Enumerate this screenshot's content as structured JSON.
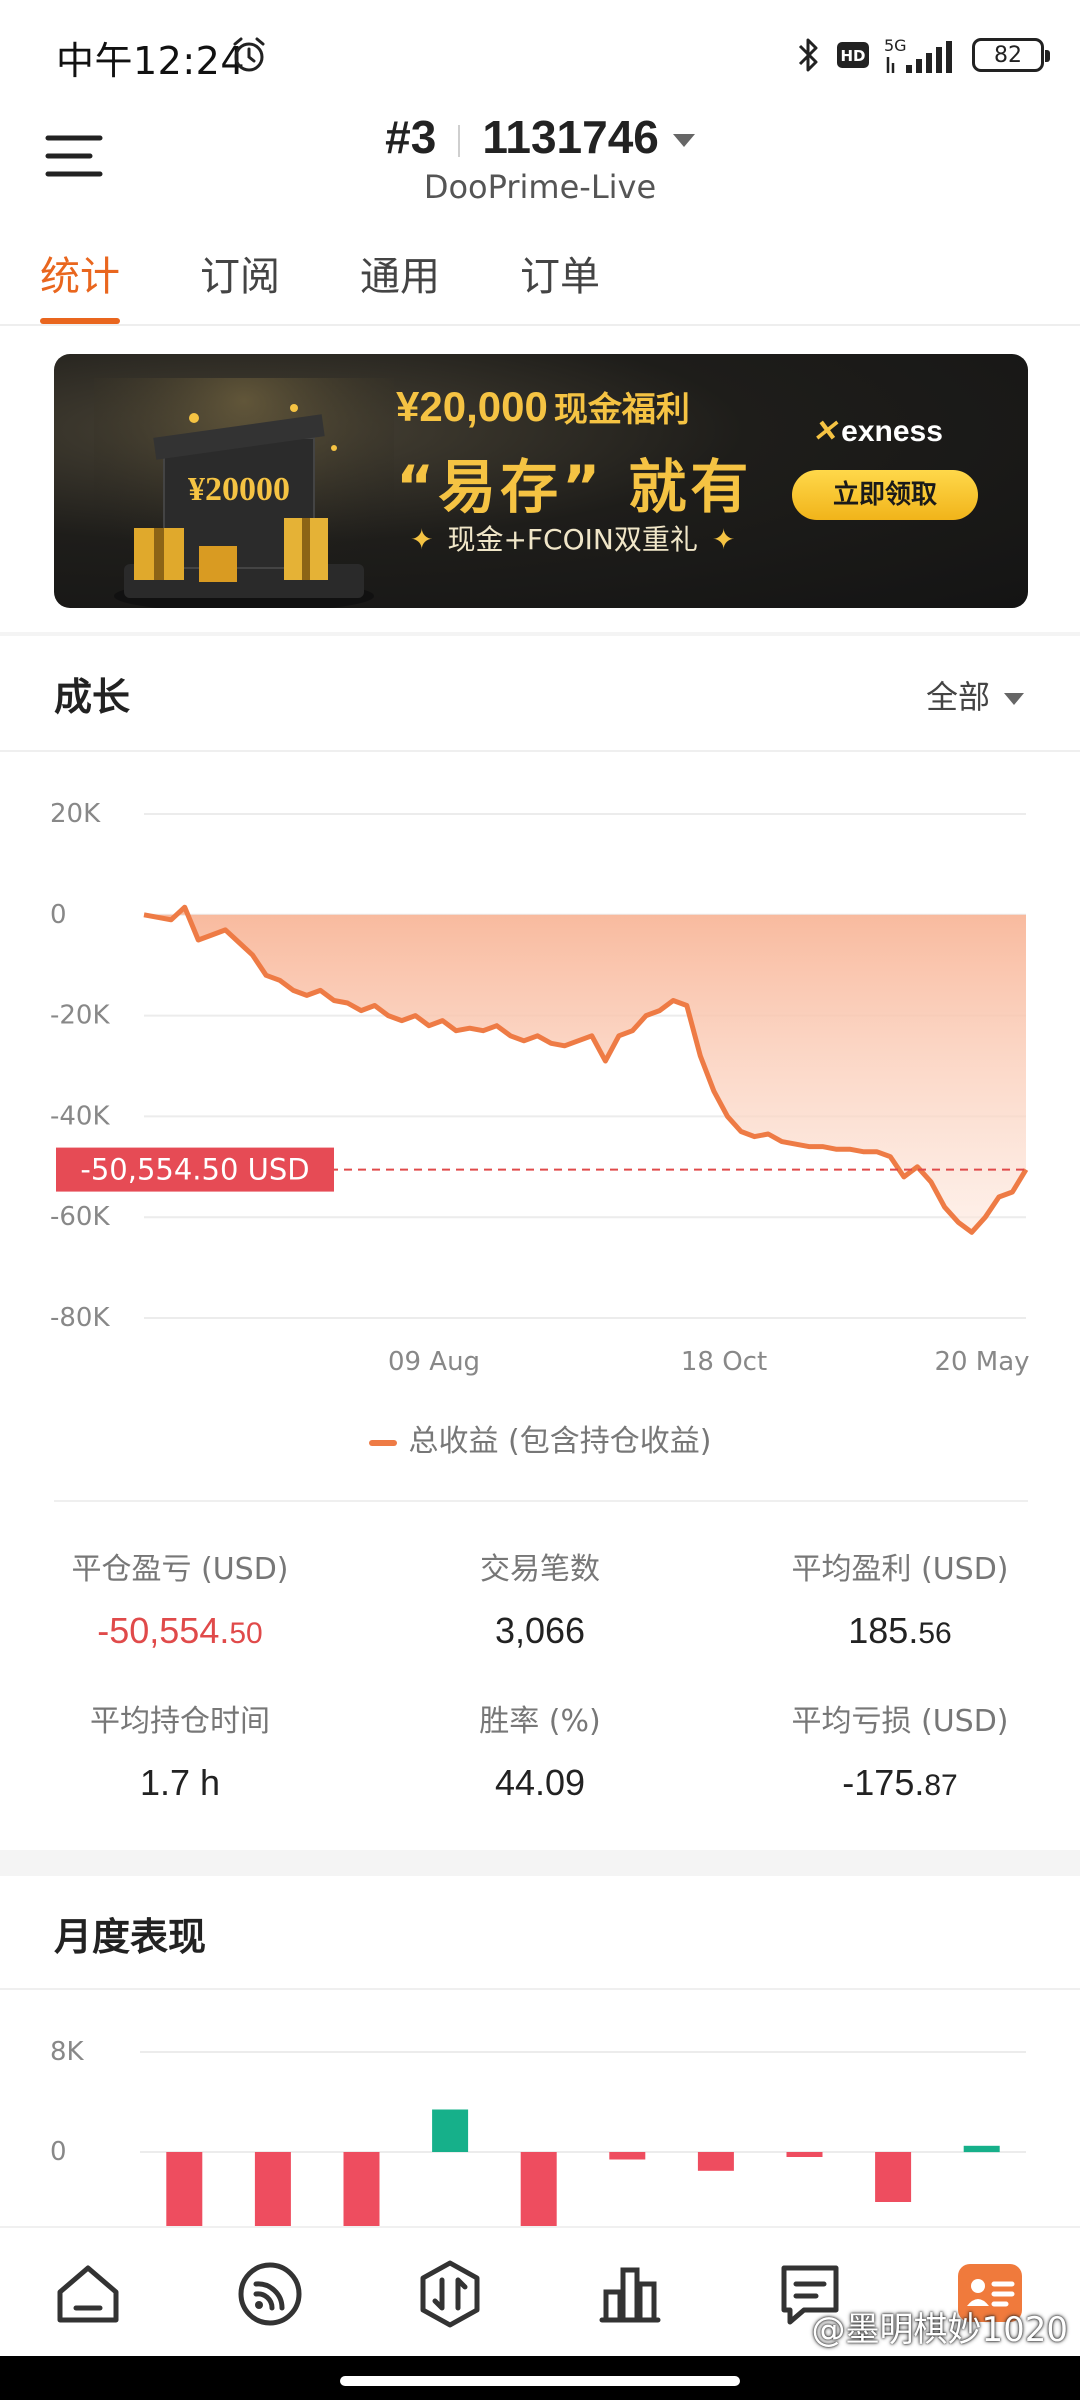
{
  "status_bar": {
    "time": "中午12:24",
    "network": "5G",
    "hd": "HD",
    "battery": "82"
  },
  "header": {
    "account_prefix": "#3",
    "account_number": "1131746",
    "server": "DooPrime-Live"
  },
  "tabs": [
    {
      "label": "统计",
      "active": true
    },
    {
      "label": "订阅",
      "active": false
    },
    {
      "label": "通用",
      "active": false
    },
    {
      "label": "订单",
      "active": false
    }
  ],
  "banner": {
    "amount": "¥20,000",
    "amount_suffix": "现金福利",
    "slogan": "“易存” 就有",
    "sub": "现金+FCOIN双重礼",
    "gift_text": "¥20000",
    "brand": "exness",
    "button": "立即领取"
  },
  "growth": {
    "title": "成长",
    "filter": "全部",
    "legend": "总收益 (包含持仓收益)"
  },
  "stats": {
    "closed_pl_label": "平仓盈亏 (USD)",
    "closed_pl_int": "-50,554.",
    "closed_pl_dec": "50",
    "trades_label": "交易笔数",
    "trades_value": "3,066",
    "avg_profit_label": "平均盈利 (USD)",
    "avg_profit_int": "185.",
    "avg_profit_dec": "56",
    "avg_hold_label": "平均持仓时间",
    "avg_hold_value": "1.7 h",
    "win_rate_label": "胜率 (%)",
    "win_rate_value": "44.09",
    "avg_loss_label": "平均亏损 (USD)",
    "avg_loss_int": "-175.",
    "avg_loss_dec": "87"
  },
  "monthly": {
    "title": "月度表现"
  },
  "watermark": "@墨明棋妙1020",
  "colors": {
    "accent": "#e9661e",
    "line": "#ee7b45",
    "negative": "#e04a4a",
    "bar_negative": "#ee4d5f",
    "bar_positive": "#16b08a"
  },
  "chart_data": [
    {
      "type": "area",
      "title": "成长",
      "ylim": [
        -80000,
        20000
      ],
      "y_ticks": [
        "20K",
        "0",
        "-20K",
        "-40K",
        "-60K",
        "-80K"
      ],
      "x_ticks": [
        "09 Aug",
        "18 Oct",
        "20 May"
      ],
      "series": [
        {
          "name": "总收益 (包含持仓收益)",
          "values": [
            0,
            -500,
            -1000,
            1500,
            -5000,
            -4000,
            -3000,
            -5500,
            -8000,
            -12000,
            -13000,
            -15000,
            -16000,
            -15000,
            -17000,
            -17500,
            -19000,
            -18000,
            -20000,
            -21000,
            -20000,
            -22000,
            -21000,
            -23000,
            -22500,
            -23000,
            -22000,
            -24000,
            -25000,
            -24000,
            -25500,
            -26000,
            -25000,
            -24000,
            -29000,
            -24000,
            -23000,
            -20000,
            -19000,
            -17000,
            -18000,
            -28000,
            -35000,
            -40000,
            -43000,
            -44000,
            -43500,
            -45000,
            -45500,
            -46000,
            -46000,
            -46500,
            -46500,
            -47000,
            -47000,
            -48000,
            -52000,
            -50000,
            -53000,
            -58000,
            -61000,
            -63000,
            -60000,
            -56000,
            -55000,
            -50554.5
          ]
        }
      ],
      "current_value_label": "-50,554.50 USD",
      "current_value": -50554.5
    },
    {
      "type": "bar",
      "title": "月度表现",
      "y_ticks": [
        "8K",
        "0"
      ],
      "values": [
        -14000,
        -14000,
        -13000,
        3400,
        -14000,
        -600,
        -1500,
        -400,
        -4000,
        500
      ]
    }
  ]
}
